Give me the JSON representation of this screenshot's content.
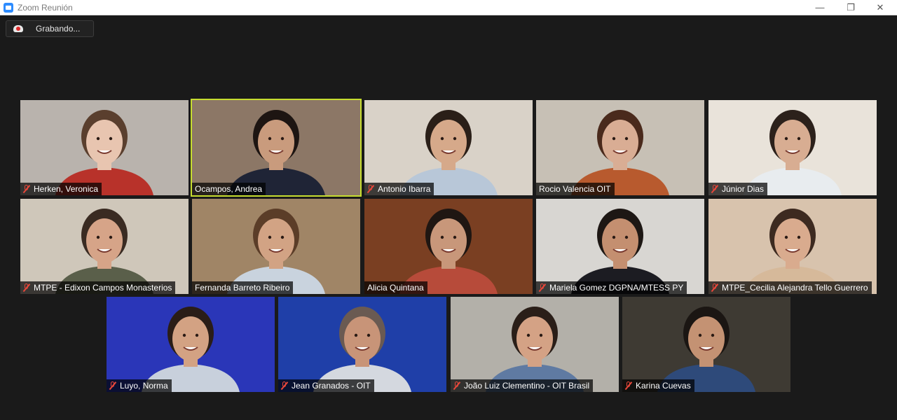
{
  "window": {
    "title": "Zoom Reunión",
    "recording_label": "Grabando...",
    "controls": {
      "minimize": "—",
      "restore": "❐",
      "close": "✕"
    }
  },
  "participants": [
    {
      "name": "Herken, Veronica",
      "muted": true,
      "bg": "#b9b3ad",
      "skin": "#e8c5b0",
      "hair": "#5a3f2e",
      "shirt": "#b8322a"
    },
    {
      "name": "Ocampos, Andrea",
      "muted": false,
      "active": true,
      "bg": "#8c7766",
      "skin": "#c99b7d",
      "hair": "#1d1512",
      "shirt": "#1f2436"
    },
    {
      "name": "Antonio Ibarra",
      "muted": true,
      "bg": "#d9d2c8",
      "skin": "#d6a98a",
      "hair": "#2a1f18",
      "shirt": "#b8c7d8"
    },
    {
      "name": "Rocio Valencia OIT",
      "muted": false,
      "bg": "#c7c0b5",
      "skin": "#d9ad94",
      "hair": "#4a2a1c",
      "shirt": "#b85a2e"
    },
    {
      "name": "Júnior Dias",
      "muted": true,
      "bg": "#e9e3da",
      "skin": "#d8ad92",
      "hair": "#2c211b",
      "shirt": "#e8ecef"
    },
    {
      "name": "MTPE - Edixon Campos Monasterios",
      "muted": true,
      "bg": "#cfc7ba",
      "skin": "#d6a488",
      "hair": "#3a2b22",
      "shirt": "#5a5f4a"
    },
    {
      "name": "Fernanda Barreto Ribeiro",
      "muted": false,
      "bg": "#a08566",
      "skin": "#d2a384",
      "hair": "#5b3d28",
      "shirt": "#c9d3de"
    },
    {
      "name": "Alicia Quintana",
      "muted": false,
      "bg": "#7a3f22",
      "skin": "#c8977a",
      "hair": "#1f1612",
      "shirt": "#b74b3a"
    },
    {
      "name": "Mariela Gomez DGPNA/MTESS PY",
      "muted": true,
      "bg": "#d8d6d2",
      "skin": "#c48f70",
      "hair": "#1d1714",
      "shirt": "#1c1c22"
    },
    {
      "name": "MTPE_Cecilia Alejandra Tello Guerrero",
      "muted": true,
      "bg": "#d8c3ad",
      "skin": "#d9ab8e",
      "hair": "#3d2a20",
      "shirt": "#d6b99a"
    },
    {
      "name": "Luyo, Norma",
      "muted": true,
      "bg": "#2a36b8",
      "skin": "#d3a283",
      "hair": "#2a1d17",
      "shirt": "#c8d0dc"
    },
    {
      "name": "Jean Granados - OIT",
      "muted": true,
      "bg": "#1f3fa8",
      "skin": "#c89478",
      "hair": "#6a5a52",
      "shirt": "#d4d8df"
    },
    {
      "name": "João Luiz Clementino - OIT Brasil",
      "muted": true,
      "bg": "#b3b0a9",
      "skin": "#d4a285",
      "hair": "#2a1e18",
      "shirt": "#5f7aa2"
    },
    {
      "name": "Karina Cuevas",
      "muted": true,
      "bg": "#3e3a33",
      "skin": "#c49273",
      "hair": "#1b1613",
      "shirt": "#2e4a7a"
    }
  ]
}
